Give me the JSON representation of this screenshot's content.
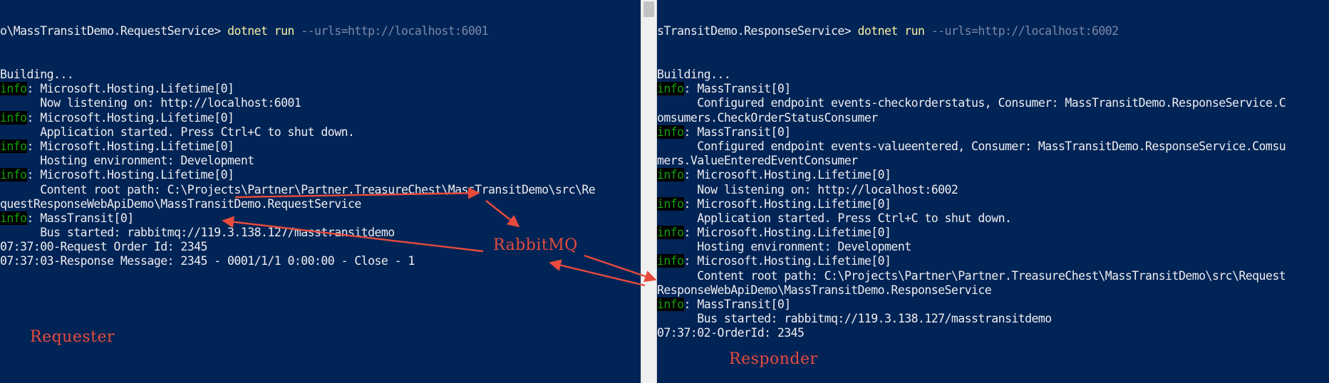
{
  "left": {
    "prompt": "o\\MassTransitDemo.RequestService> ",
    "command": "dotnet run",
    "args": " --urls=http://localhost:6001",
    "lines": [
      {
        "text": "Building..."
      },
      {
        "tag": "info",
        "text": ": Microsoft.Hosting.Lifetime[0]"
      },
      {
        "text": "      Now listening on: http://localhost:6001"
      },
      {
        "tag": "info",
        "text": ": Microsoft.Hosting.Lifetime[0]"
      },
      {
        "text": "      Application started. Press Ctrl+C to shut down."
      },
      {
        "tag": "info",
        "text": ": Microsoft.Hosting.Lifetime[0]"
      },
      {
        "text": "      Hosting environment: Development"
      },
      {
        "tag": "info",
        "text": ": Microsoft.Hosting.Lifetime[0]"
      },
      {
        "text": "      Content root path: C:\\Projects\\Partner\\Partner.TreasureChest\\MassTransitDemo\\src\\Re"
      },
      {
        "text": "questResponseWebApiDemo\\MassTransitDemo.RequestService"
      },
      {
        "tag": "info",
        "text": ": MassTransit[0]"
      },
      {
        "text": "      Bus started: rabbitmq://119.3.138.127/masstransitdemo"
      },
      {
        "text": "07:37:00-Request Order Id: 2345"
      },
      {
        "text": "07:37:03-Response Message: 2345 - 0001/1/1 0:00:00 - Close - 1"
      }
    ]
  },
  "right": {
    "prompt": "sTransitDemo.ResponseService> ",
    "command": "dotnet run",
    "args": " --urls=http://localhost:6002",
    "lines": [
      {
        "text": "Building..."
      },
      {
        "tag": "info",
        "text": ": MassTransit[0]"
      },
      {
        "text": "      Configured endpoint events-checkorderstatus, Consumer: MassTransitDemo.ResponseService.C"
      },
      {
        "text": "omsumers.CheckOrderStatusConsumer"
      },
      {
        "tag": "info",
        "text": ": MassTransit[0]"
      },
      {
        "text": "      Configured endpoint events-valueentered, Consumer: MassTransitDemo.ResponseService.Comsu"
      },
      {
        "text": "mers.ValueEnteredEventConsumer"
      },
      {
        "tag": "info",
        "text": ": Microsoft.Hosting.Lifetime[0]"
      },
      {
        "text": "      Now listening on: http://localhost:6002"
      },
      {
        "tag": "info",
        "text": ": Microsoft.Hosting.Lifetime[0]"
      },
      {
        "text": "      Application started. Press Ctrl+C to shut down."
      },
      {
        "tag": "info",
        "text": ": Microsoft.Hosting.Lifetime[0]"
      },
      {
        "text": "      Hosting environment: Development"
      },
      {
        "tag": "info",
        "text": ": Microsoft.Hosting.Lifetime[0]"
      },
      {
        "text": "      Content root path: C:\\Projects\\Partner\\Partner.TreasureChest\\MassTransitDemo\\src\\Request"
      },
      {
        "text": "ResponseWebApiDemo\\MassTransitDemo.ResponseService"
      },
      {
        "tag": "info",
        "text": ": MassTransit[0]"
      },
      {
        "text": "      Bus started: rabbitmq://119.3.138.127/masstransitdemo"
      },
      {
        "text": "07:37:02-OrderId: 2345"
      }
    ]
  },
  "annotations": {
    "broker": "RabbitMQ",
    "requester": "Requester",
    "responder": "Responder",
    "color": "#e84b3c"
  },
  "colors": {
    "background": "#012456",
    "text": "#eeedf0",
    "info": "#13a10e",
    "command": "#f9f1a5"
  }
}
